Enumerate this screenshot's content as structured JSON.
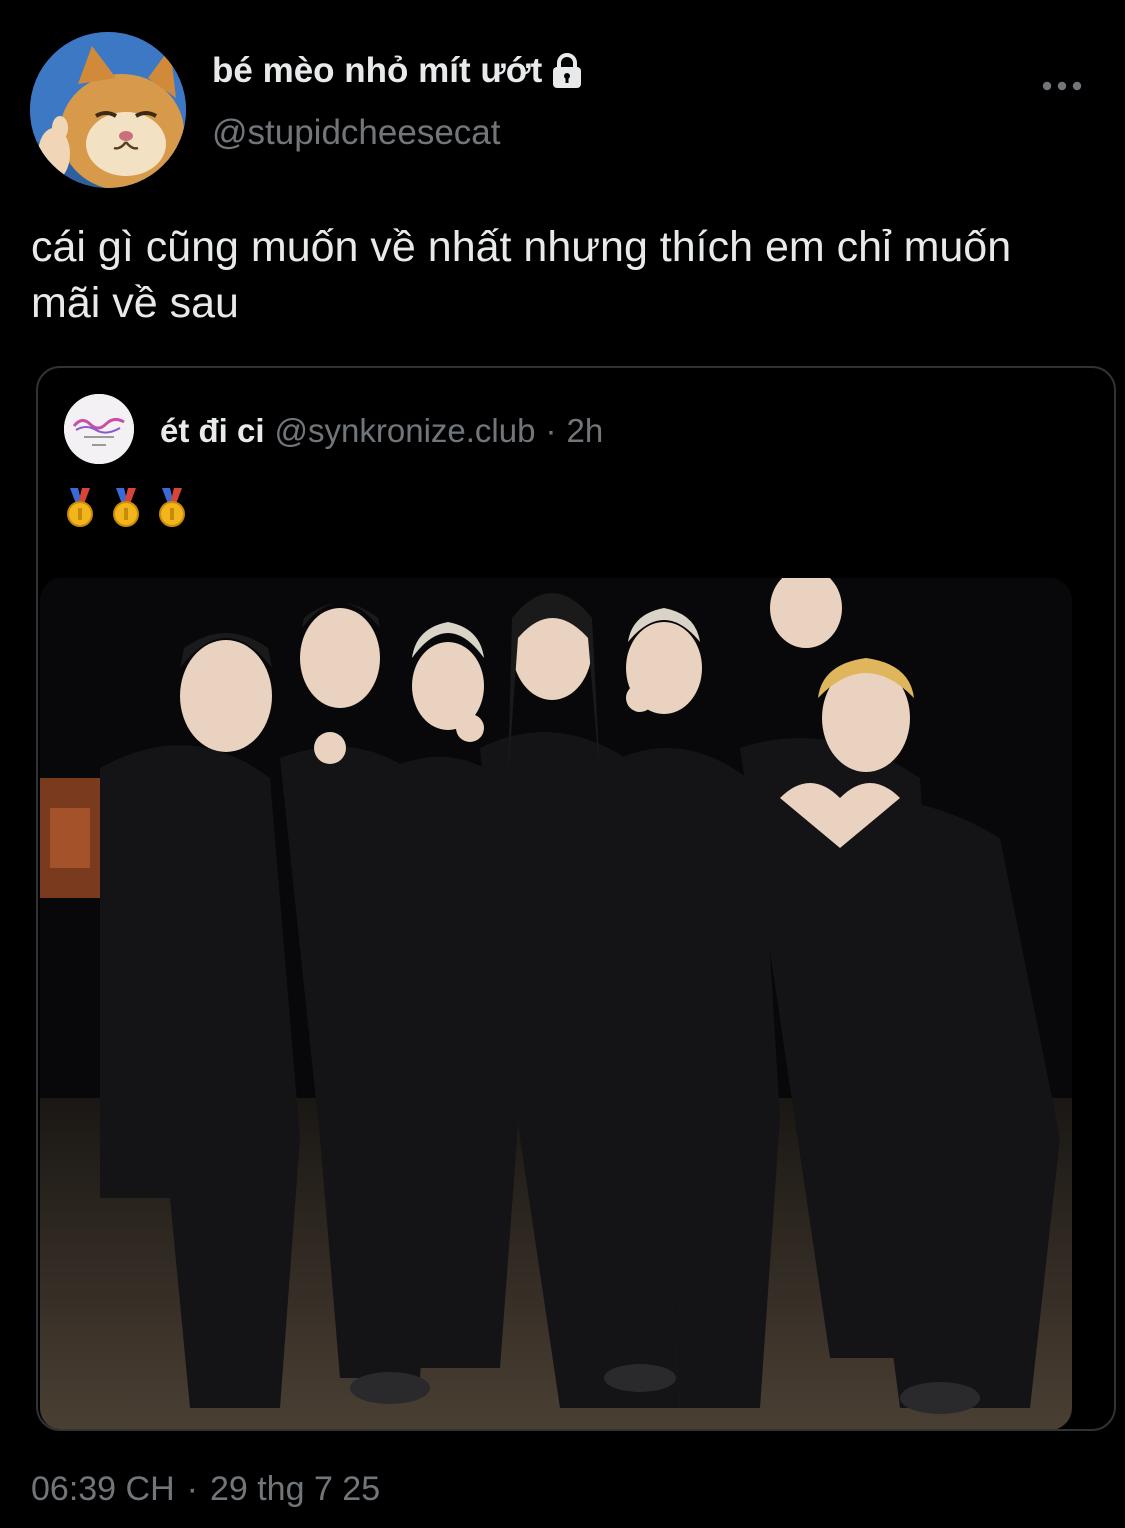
{
  "tweet": {
    "author": {
      "display_name": "bé mèo nhỏ mít ướt",
      "handle": "@stupidcheesecat",
      "avatar_icon": "cat-avatar",
      "protected_icon": "lock-icon"
    },
    "more_icon": "more-horizontal-icon",
    "text": "cái gì cũng muốn về nhất nhưng thích em chỉ muốn mãi về sau",
    "timestamp": {
      "time": "06:39 CH",
      "separator": "·",
      "date": "29 thg 7 25"
    }
  },
  "quoted_tweet": {
    "display_name": "ét đi ci",
    "handle": "@synkronize.club",
    "separator": "·",
    "time_ago": "2h",
    "avatar_icon": "synkronize-logo",
    "text_emojis": [
      "medal-icon",
      "medal-icon",
      "medal-icon"
    ],
    "media_icon": "group-photo"
  },
  "colors": {
    "background": "#000000",
    "primary_text": "#e7e9ea",
    "secondary_text": "#71767b",
    "border": "#2f3336"
  }
}
